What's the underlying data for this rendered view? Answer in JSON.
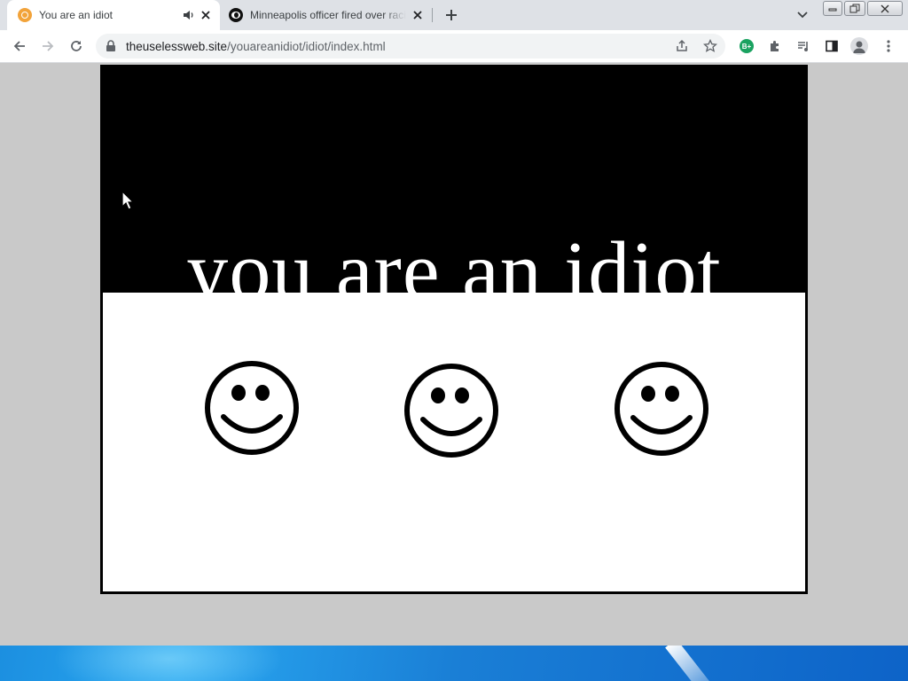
{
  "browser": {
    "tabs": [
      {
        "title": "You are an idiot",
        "active": true,
        "audio": true
      },
      {
        "title": "Minneapolis officer fired over racist",
        "active": false,
        "audio": false
      }
    ],
    "url": {
      "host": "theuselessweb.site",
      "path": "/youareanidiot/idiot/index.html"
    },
    "extension_badge": "B+",
    "icons": [
      "back-icon",
      "forward-icon",
      "reload-icon",
      "lock-icon",
      "share-icon",
      "star-icon",
      "puzzle-icon",
      "media-icon",
      "sidepanel-icon",
      "profile-icon",
      "menu-icon",
      "tab-search-icon",
      "new-tab-icon",
      "minimize-icon",
      "restore-icon",
      "close-window-icon"
    ]
  },
  "page": {
    "headline": "you are an idiot",
    "smileys": [
      "smiley-1",
      "smiley-2",
      "smiley-3"
    ]
  },
  "colors": {
    "tab_strip": "#dee1e6",
    "page_background": "#c9c9c9",
    "black": "#000000",
    "white": "#ffffff"
  }
}
